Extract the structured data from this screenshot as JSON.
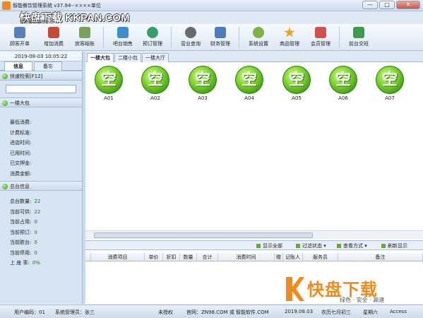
{
  "window": {
    "title": "智能餐饮管理系统 v37.94--××××单位",
    "minimize": "—",
    "maximize": "□",
    "close": "✕",
    "watermark": "快盘下载 KKPAN.COM",
    "watermark_sub": "智能餐饮管理系统"
  },
  "toolbar": [
    {
      "label": "顾客开单",
      "icon": "customer-icon",
      "color": "#5b7fb8"
    },
    {
      "label": "增加消费",
      "icon": "add-consumption-icon",
      "color": "#c94a3b"
    },
    {
      "label": "宾客结账",
      "icon": "checkout-icon",
      "color": "#7aa05a"
    },
    {
      "label": "吧台销售",
      "icon": "bar-sales-icon",
      "color": "#3a8fd1"
    },
    {
      "label": "预订管理",
      "icon": "reservation-icon",
      "color": "#35a06a"
    },
    {
      "label": "营业查询",
      "icon": "search-icon",
      "color": "#6a6a6a"
    },
    {
      "label": "财务管理",
      "icon": "finance-icon",
      "color": "#4c7cc0"
    },
    {
      "label": "系统设置",
      "icon": "gear-icon",
      "color": "#7db24a"
    },
    {
      "label": "商品管理",
      "icon": "star-icon",
      "color": "#f0a020"
    },
    {
      "label": "会员管理",
      "icon": "members-icon",
      "color": "#d05050"
    },
    {
      "label": "前台交班",
      "icon": "shift-icon",
      "color": "#3f9a50"
    }
  ],
  "left": {
    "datetime": "2019-08-03  10:05:22",
    "tabs": [
      "信息",
      "备忘"
    ],
    "quick_search_label": "快速检索[F12]",
    "table_section": "一楼大包",
    "table_info": [
      "最低消费:",
      "计费标准:",
      "进店时间:",
      "已用时间:",
      "已交押金:",
      "消费金额:"
    ],
    "summary_section": "总台信息",
    "summary": [
      {
        "label": "总台数量:",
        "value": "22"
      },
      {
        "label": "当前可供:",
        "value": "22"
      },
      {
        "label": "当前占用:",
        "value": "0"
      },
      {
        "label": "当前预订:",
        "value": "0"
      },
      {
        "label": "当前脏台:",
        "value": "0"
      },
      {
        "label": "当前停用:",
        "value": "0"
      },
      {
        "label": "上 座 率:",
        "value": "0%"
      }
    ]
  },
  "main": {
    "tabs": [
      "一楼大包",
      "二楼小包",
      "一楼大厅"
    ],
    "tables": [
      {
        "glyph": "空",
        "id": "A01"
      },
      {
        "glyph": "空",
        "id": "A02"
      },
      {
        "glyph": "空",
        "id": "A03"
      },
      {
        "glyph": "空",
        "id": "A04"
      },
      {
        "glyph": "空",
        "id": "A05"
      },
      {
        "glyph": "空",
        "id": "A06"
      },
      {
        "glyph": "空",
        "id": "A07"
      }
    ],
    "filters": [
      "显示全部",
      "过滤状态 ▾",
      "查看方式 ▾",
      "刷新显示"
    ],
    "order_columns": [
      "消费项目",
      "单价",
      "折扣",
      "数量",
      "合计",
      "消费时间",
      "赠",
      "记账人",
      "服务员",
      "备注"
    ]
  },
  "statusbar": {
    "user": "用户编码：01",
    "admin": "系统管理员：张三",
    "license": "未授权",
    "site": "官网：ZN98.COM 或 智能软件.COM",
    "date": "2019.08.03",
    "lunar": "农历七月初三",
    "weekday": "星期六",
    "db": "Access"
  },
  "logo": {
    "text": "快盘下载",
    "slogan": "绿色 · 安全 · 高速"
  }
}
